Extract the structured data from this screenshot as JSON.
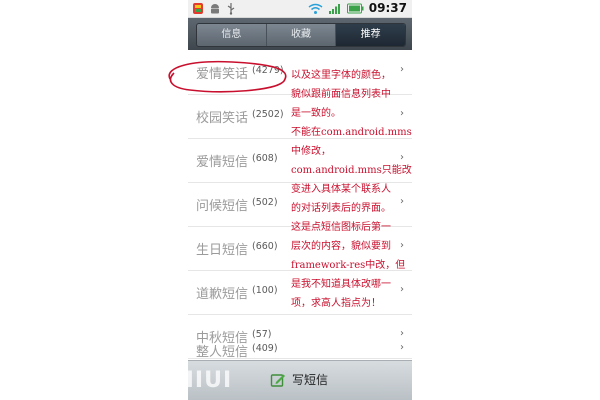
{
  "status_bar": {
    "time": "09:37"
  },
  "tabs": [
    {
      "label": "信息",
      "active": false
    },
    {
      "label": "收藏",
      "active": false
    },
    {
      "label": "推荐",
      "active": true
    }
  ],
  "list": [
    {
      "name": "爱情笑话",
      "count": "(4279)"
    },
    {
      "name": "校园笑话",
      "count": "(2502)"
    },
    {
      "name": "爱情短信",
      "count": "(608)"
    },
    {
      "name": "问候短信",
      "count": "(502)"
    },
    {
      "name": "生日短信",
      "count": "(660)"
    },
    {
      "name": "道歉短信",
      "count": "(100)"
    },
    {
      "name": "中秋短信",
      "count": "(57)"
    },
    {
      "name": "整人短信",
      "count": "(409)"
    }
  ],
  "chevron": "›",
  "compose": {
    "label": "写短信"
  },
  "watermark": "MIUI",
  "annotation": [
    "以及这里字体的颜色，",
    "貌似跟前面信息列表中",
    "是一致的。",
    "不能在com.android.mms",
    "中修改，",
    "com.android.mms只能改",
    "变进入具体某个联系人",
    "的对话列表后的界面。",
    "这是点短信图标后第一",
    "层次的内容，貌似要到",
    "framework-res中改，但",
    "是我不知道具体改哪一",
    "项，求高人指点为！"
  ],
  "colors": {
    "annotation": "#c8102e",
    "tab_active": "#2f3d4b",
    "list_name": "#9b9b9b"
  }
}
